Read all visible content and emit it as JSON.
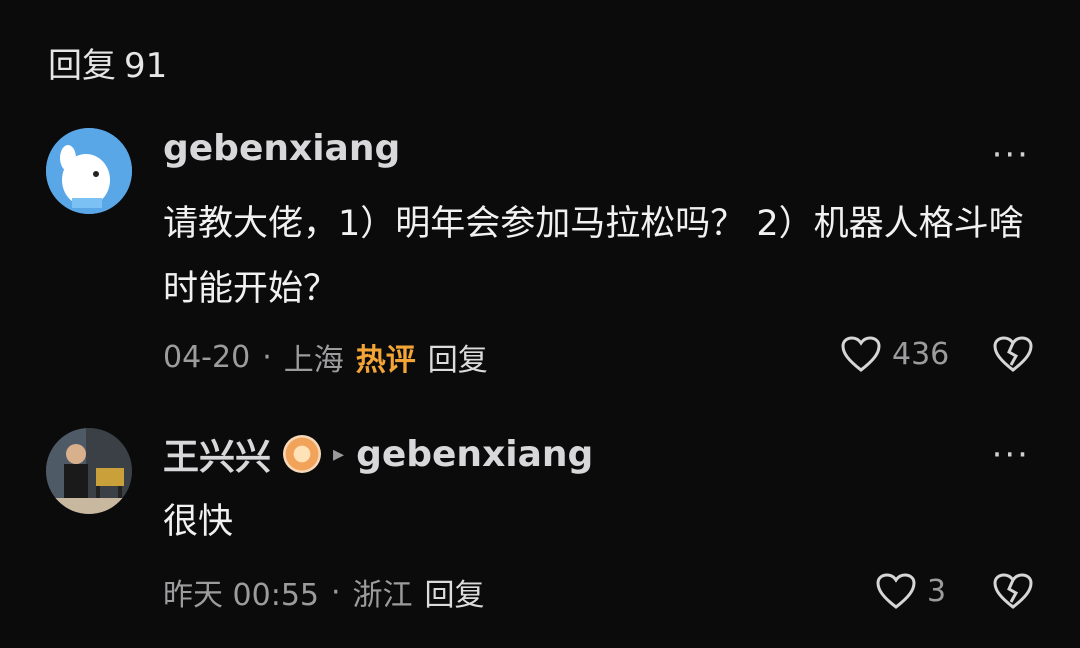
{
  "header": {
    "title": "回复",
    "count": "91"
  },
  "comments": [
    {
      "username": "gebenxiang",
      "text": "请教大佬，1）明年会参加马拉松吗？ 2）机器人格斗啥时能开始？",
      "date": "04-20",
      "separator": "·",
      "location": "上海",
      "hot_label": "热评",
      "reply_label": "回复",
      "likes": "436"
    },
    {
      "username": "王兴兴",
      "reply_arrow": "▸",
      "reply_to": "gebenxiang",
      "text": "很快",
      "date": "昨天 00:55",
      "separator": "·",
      "location": "浙江",
      "reply_label": "回复",
      "likes": "3"
    }
  ],
  "icons": {
    "more": "more-dots-icon",
    "like": "heart-outline-icon",
    "dislike": "broken-heart-icon",
    "badge": "verified-badge-icon"
  },
  "colors": {
    "accent_hot": "#f3a536",
    "background": "#0b0b0c"
  }
}
